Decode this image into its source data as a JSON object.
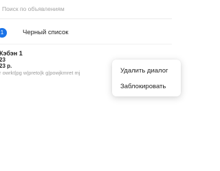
{
  "search": {
    "placeholder": "Поиск по объявлениям"
  },
  "blacklist": {
    "count": "1",
    "label": "Черный список"
  },
  "chat": {
    "name": "Кэбэн 1",
    "line2": "23",
    "price": "23 р.",
    "preview": "r owrkt|pg w|preto|k g|powjkmret mj"
  },
  "context_menu": {
    "delete_label": "Удалить диалог",
    "block_label": "Заблокировать"
  },
  "colors": {
    "accent": "#1a73e8",
    "muted_text": "#9a9a9a"
  }
}
